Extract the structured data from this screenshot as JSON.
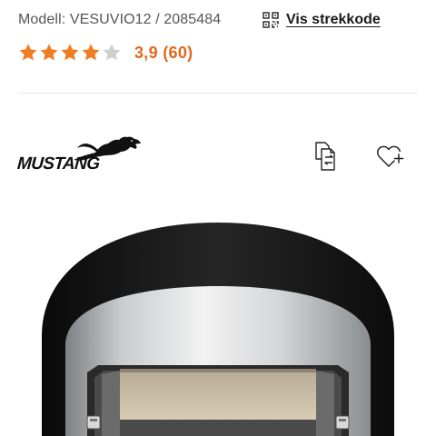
{
  "product": {
    "model_text": "Modell: VESUVIO12 / 2085484",
    "barcode_link_label": "Vis strekkode",
    "barcode_icon": "qr-code-icon",
    "rating": {
      "value": 3.9,
      "max": 5,
      "display": "3,9 (60)",
      "star_color": "#f07d22",
      "empty_star_color": "#cfcfcf"
    },
    "brand_logo_text": "MUSTANG",
    "actions": {
      "compare_icon": "compare-icon",
      "wishlist_icon": "heart-plus-icon"
    },
    "image_alt_icon": "pizza-oven-image"
  }
}
